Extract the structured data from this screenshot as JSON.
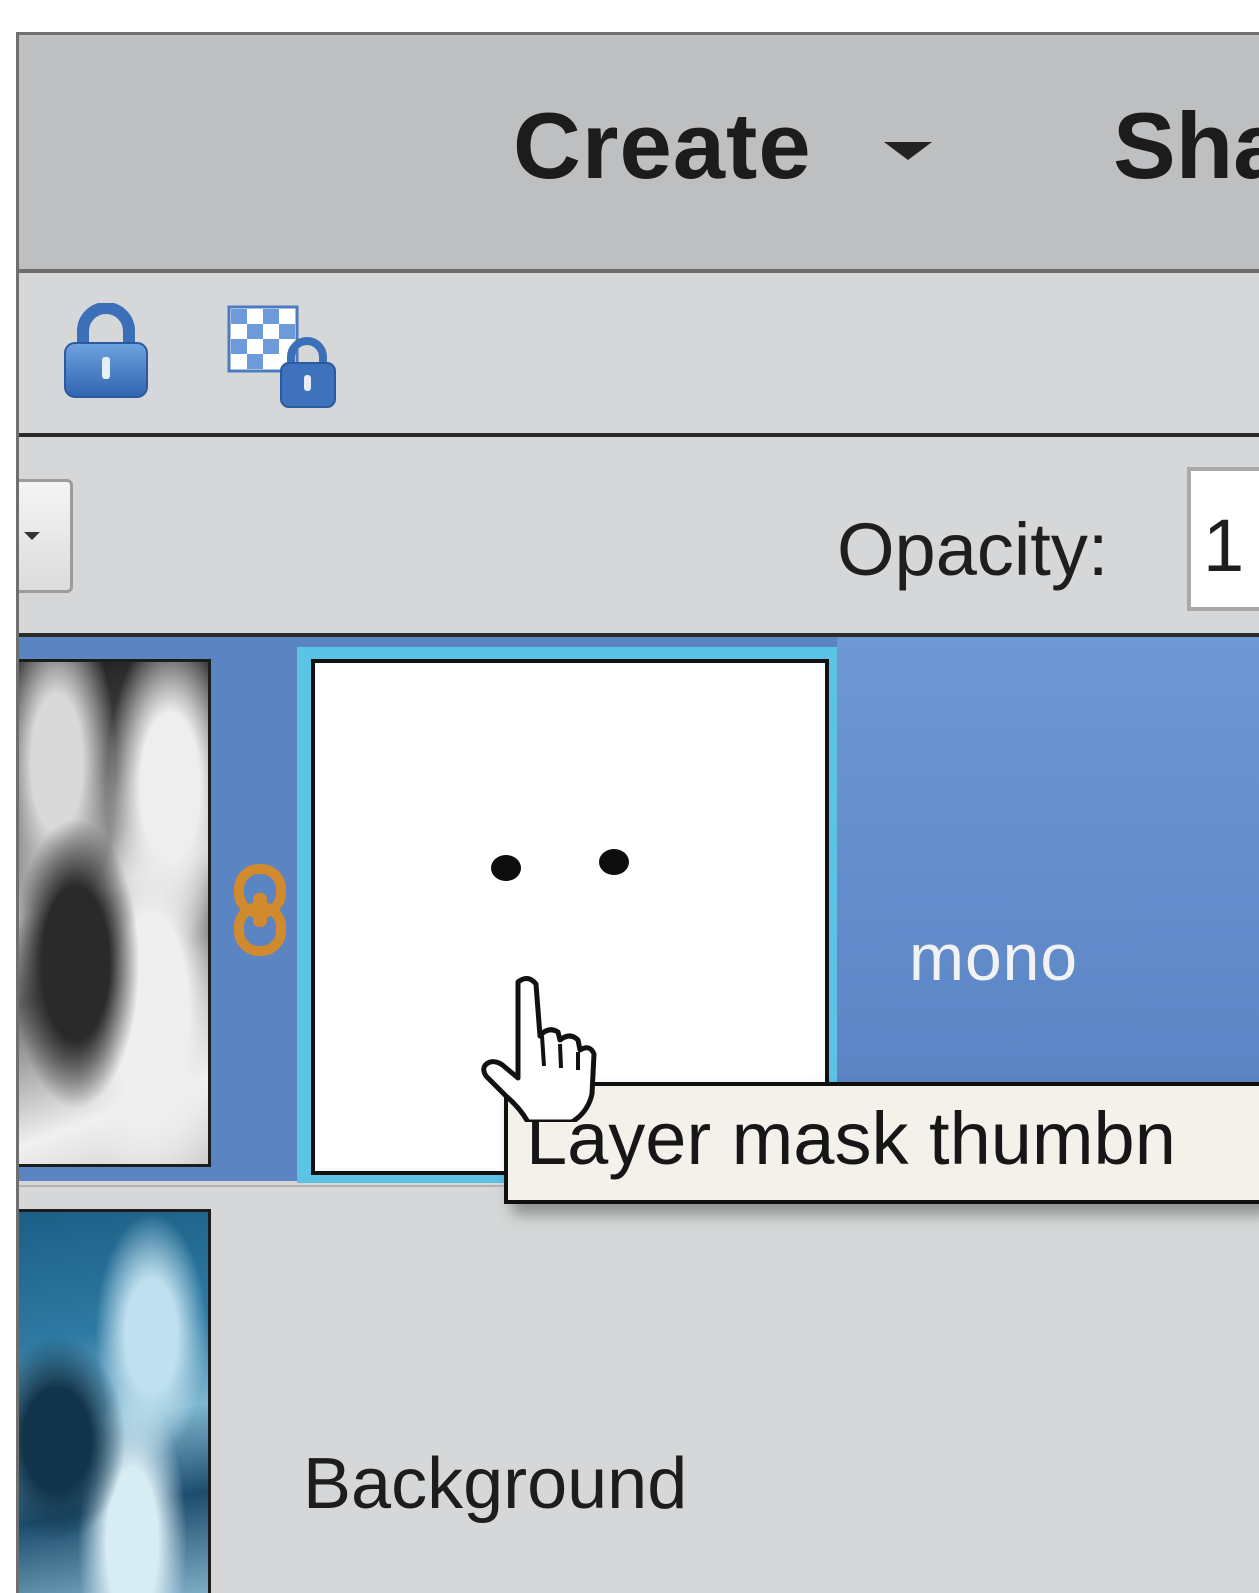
{
  "toolbar": {
    "create_label": "Create",
    "share_label": "Sha"
  },
  "lock_bar": {
    "lock_all_icon": "lock-icon",
    "lock_transparency_icon": "lock-transparent-pixels-icon"
  },
  "options": {
    "opacity_label": "Opacity:",
    "opacity_value": "1"
  },
  "layers": [
    {
      "name": "mono",
      "selected": true,
      "has_mask": true,
      "linked": true
    },
    {
      "name": "Background",
      "selected": false
    }
  ],
  "tooltip": {
    "text": "Layer mask thumbn"
  },
  "colors": {
    "selected_row": "#5a84c2",
    "mask_highlight": "#5bc3e6",
    "topbar": "#bebfc0",
    "panel": "#d5d7d8",
    "chain": "#d28a2e"
  }
}
